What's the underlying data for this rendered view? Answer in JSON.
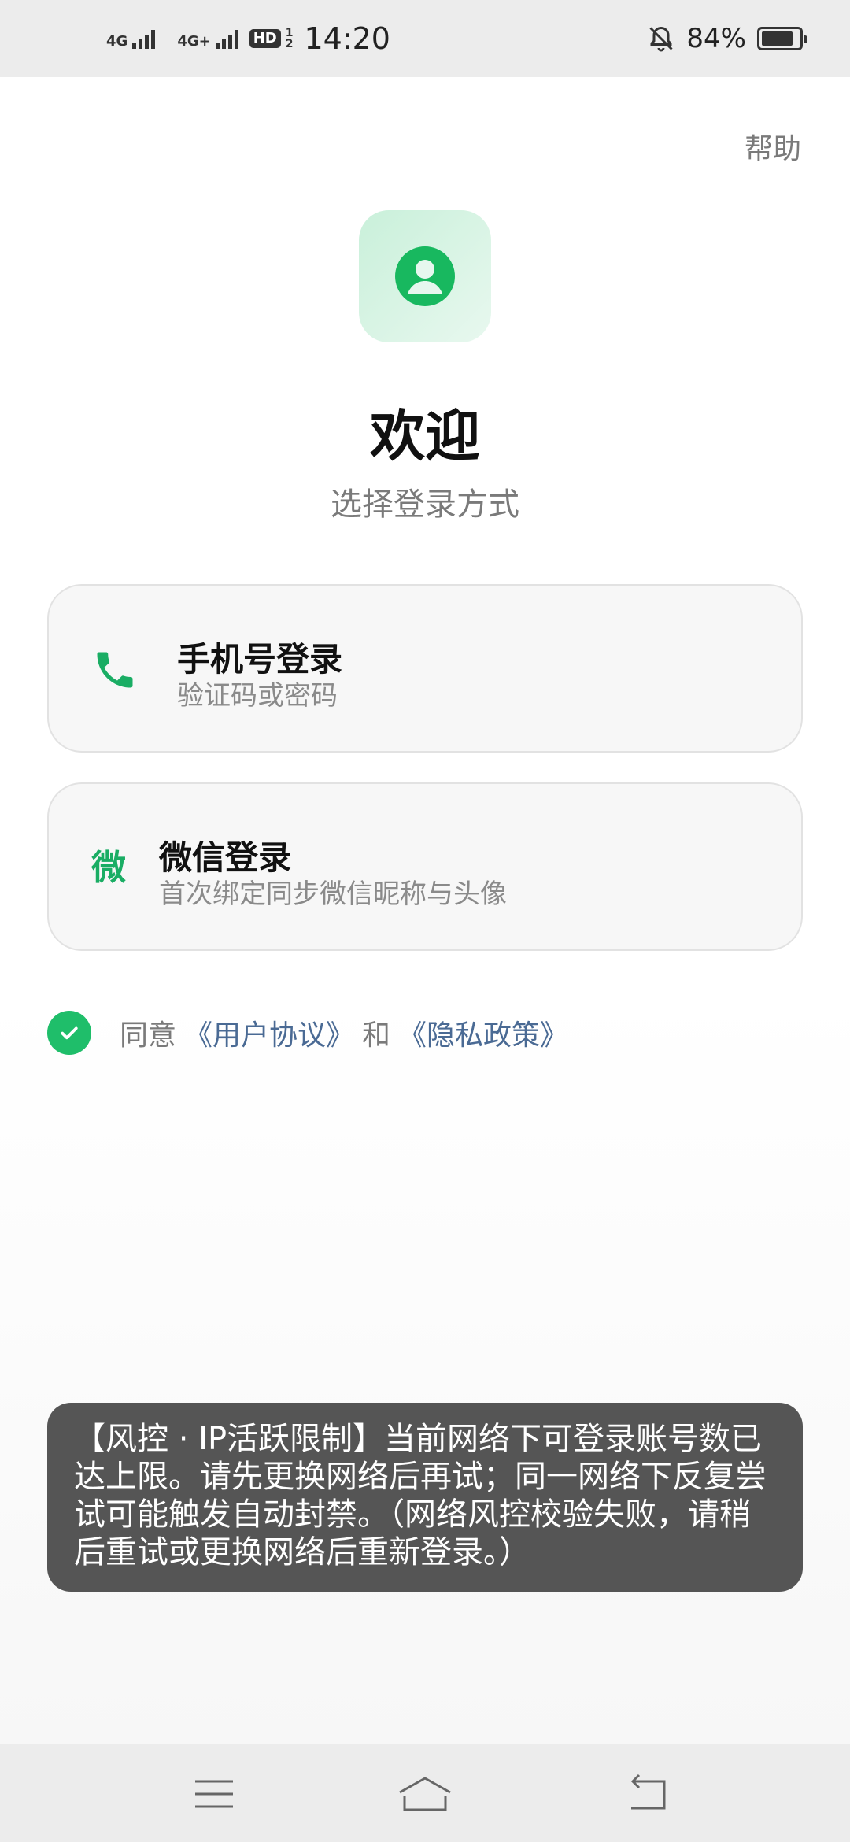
{
  "status_bar": {
    "network1": "4G",
    "network2": "4G+",
    "hd_badge": "HD",
    "hd_top": "1",
    "hd_bottom": "2",
    "time": "14:20",
    "battery_text": "84%",
    "battery_level": 0.84
  },
  "header": {
    "help_label": "帮助"
  },
  "welcome": {
    "title": "欢迎",
    "subtitle": "选择登录方式"
  },
  "login_options": [
    {
      "title": "手机号登录",
      "subtitle": "验证码或密码",
      "icon": "phone-icon"
    },
    {
      "title": "微信登录",
      "subtitle": "首次绑定同步微信昵称与头像",
      "icon_glyph": "微"
    }
  ],
  "agreement": {
    "prefix": "同意",
    "user_agreement": "《用户协议》",
    "and": "和",
    "privacy_policy": "《隐私政策》",
    "checked": true
  },
  "toast": {
    "message": "【风控 · IP活跃限制】当前网络下可登录账号数已达上限。请先更换网络后再试；同一网络下反复尝试可能触发自动封禁。（网络风控校验失败，请稍后重试或更换网络后重新登录。）"
  },
  "colors": {
    "accent": "#1fbe6a",
    "link": "#4a6a94",
    "toast_bg": "#555555"
  }
}
